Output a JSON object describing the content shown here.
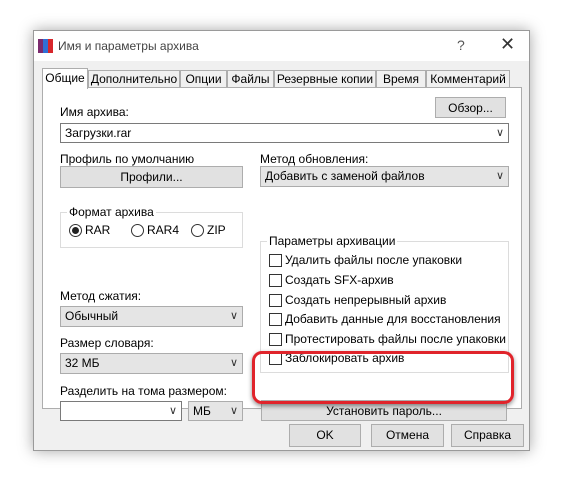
{
  "window": {
    "title": "Имя и параметры архива",
    "help": "?",
    "close": "✕"
  },
  "tabs": [
    {
      "label": "Общие",
      "active": true
    },
    {
      "label": "Дополнительно"
    },
    {
      "label": "Опции"
    },
    {
      "label": "Файлы"
    },
    {
      "label": "Резервные копии"
    },
    {
      "label": "Время"
    },
    {
      "label": "Комментарий"
    }
  ],
  "archive_name": {
    "label": "Имя архива:",
    "value": "Загрузки.rar",
    "browse_label": "Обзор..."
  },
  "profile": {
    "label": "Профиль по умолчанию",
    "button_label": "Профили..."
  },
  "update_method": {
    "label": "Метод обновления:",
    "value": "Добавить с заменой файлов"
  },
  "archive_format": {
    "label": "Формат архива",
    "options": [
      {
        "label": "RAR",
        "selected": true
      },
      {
        "label": "RAR4",
        "selected": false
      },
      {
        "label": "ZIP",
        "selected": false
      }
    ]
  },
  "compression": {
    "label": "Метод сжатия:",
    "value": "Обычный"
  },
  "dictionary": {
    "label": "Размер словаря:",
    "value": "32 МБ"
  },
  "split": {
    "label": "Разделить на тома размером:",
    "value": "",
    "unit": "МБ"
  },
  "archive_options": {
    "label": "Параметры архивации",
    "items": [
      {
        "label": "Удалить файлы после упаковки",
        "checked": false
      },
      {
        "label": "Создать SFX-архив",
        "checked": false
      },
      {
        "label": "Создать непрерывный архив",
        "checked": false
      },
      {
        "label": "Добавить данные для восстановления",
        "checked": false
      },
      {
        "label": "Протестировать файлы после упаковки",
        "checked": false
      },
      {
        "label": "Заблокировать архив",
        "checked": false
      }
    ]
  },
  "set_password_label": "Установить пароль...",
  "footer": {
    "ok": "OK",
    "cancel": "Отмена",
    "help": "Справка"
  },
  "colors": {
    "highlight": "#e0242b",
    "icon": [
      "#d7262b",
      "#2f6fd6",
      "#3a9b3a"
    ]
  }
}
